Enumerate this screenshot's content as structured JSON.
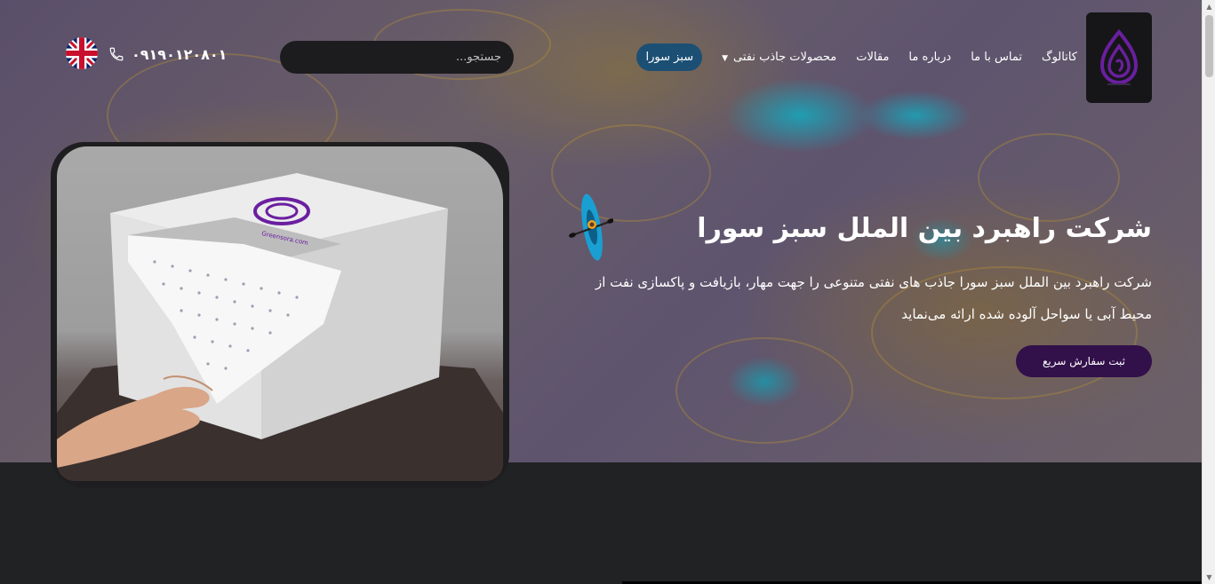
{
  "header": {
    "nav": [
      {
        "label": "سبز سورا",
        "active": true
      },
      {
        "label": "محصولات جاذب نفتی",
        "dropdown": true
      },
      {
        "label": "مقالات"
      },
      {
        "label": "درباره ما"
      },
      {
        "label": "تماس با ما"
      },
      {
        "label": "کاتالوگ"
      }
    ],
    "search_placeholder": "جستجو...",
    "phone": "۰۹۱۹۰۱۲۰۸۰۱",
    "language_icon": "uk-flag-icon",
    "phone_icon": "phone-icon"
  },
  "hero": {
    "title": "شرکت راهبرد بین الملل سبز سورا",
    "description": "شرکت راهبرد بین الملل سبز سورا جاذب های نفتی متنوعی را جهت مهار، بازیافت و پاکسازی نفت از محیط آبی یا سواحل آلوده شده ارائه می‌نماید",
    "cta_label": "ثبت سفارش سریع"
  },
  "product_image": {
    "box_print": "Greensora.com"
  },
  "colors": {
    "accent": "#1c4f74",
    "cta": "#32104a",
    "brand_purple": "#6a1fa0",
    "page_bg": "#212224"
  }
}
